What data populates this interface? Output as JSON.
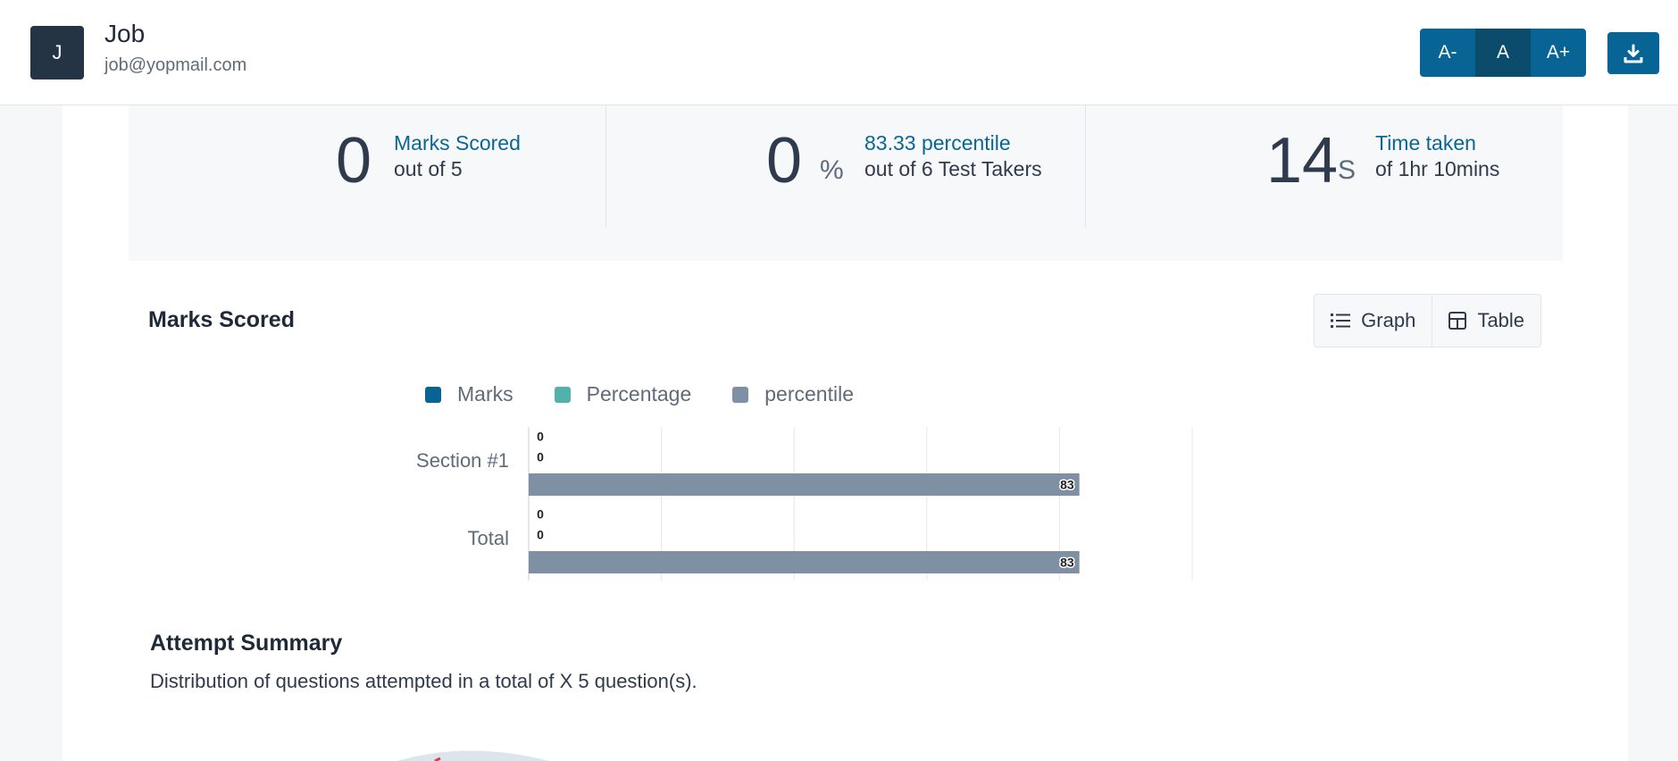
{
  "header": {
    "avatar_letter": "J",
    "user_name": "Job",
    "user_email": "job@yopmail.com",
    "font_controls": [
      "A-",
      "A",
      "A+"
    ],
    "active_font_control": "A",
    "download_icon": "download-icon"
  },
  "stats": {
    "marks": {
      "value": "0",
      "title": "Marks Scored",
      "subtitle": "out of 5"
    },
    "percentile": {
      "value": "0",
      "unit": "%",
      "title": "83.33 percentile",
      "subtitle": "out of 6 Test Takers"
    },
    "time": {
      "value": "14",
      "unit": "S",
      "title": "Time taken",
      "subtitle": "of 1hr 10mins"
    }
  },
  "marks_section": {
    "title": "Marks Scored",
    "toggle": {
      "graph_label": "Graph",
      "table_label": "Table",
      "graph_icon": "list-icon",
      "table_icon": "table-icon"
    }
  },
  "chart_data": {
    "type": "bar",
    "orientation": "horizontal",
    "categories": [
      "Section #1",
      "Total"
    ],
    "series": [
      {
        "name": "Marks",
        "values": [
          0,
          0
        ],
        "color": "#086494"
      },
      {
        "name": "Percentage",
        "values": [
          0,
          0
        ],
        "color": "#52b0ad"
      },
      {
        "name": "percentile",
        "values": [
          83,
          83
        ],
        "color": "#8090a4"
      }
    ],
    "data_labels": [
      [
        "0",
        "0",
        "83"
      ],
      [
        "0",
        "0",
        "83"
      ]
    ],
    "xlim": [
      0,
      100
    ],
    "grid": true,
    "legend_position": "top"
  },
  "attempt_summary": {
    "title": "Attempt Summary",
    "description": "Distribution of questions attempted in a total of X 5 question(s)."
  },
  "colors": {
    "accent": "#086494",
    "accent_dark": "#0b4b6c",
    "marks": "#086494",
    "percentage": "#52b0ad",
    "percentile": "#8090a4"
  }
}
